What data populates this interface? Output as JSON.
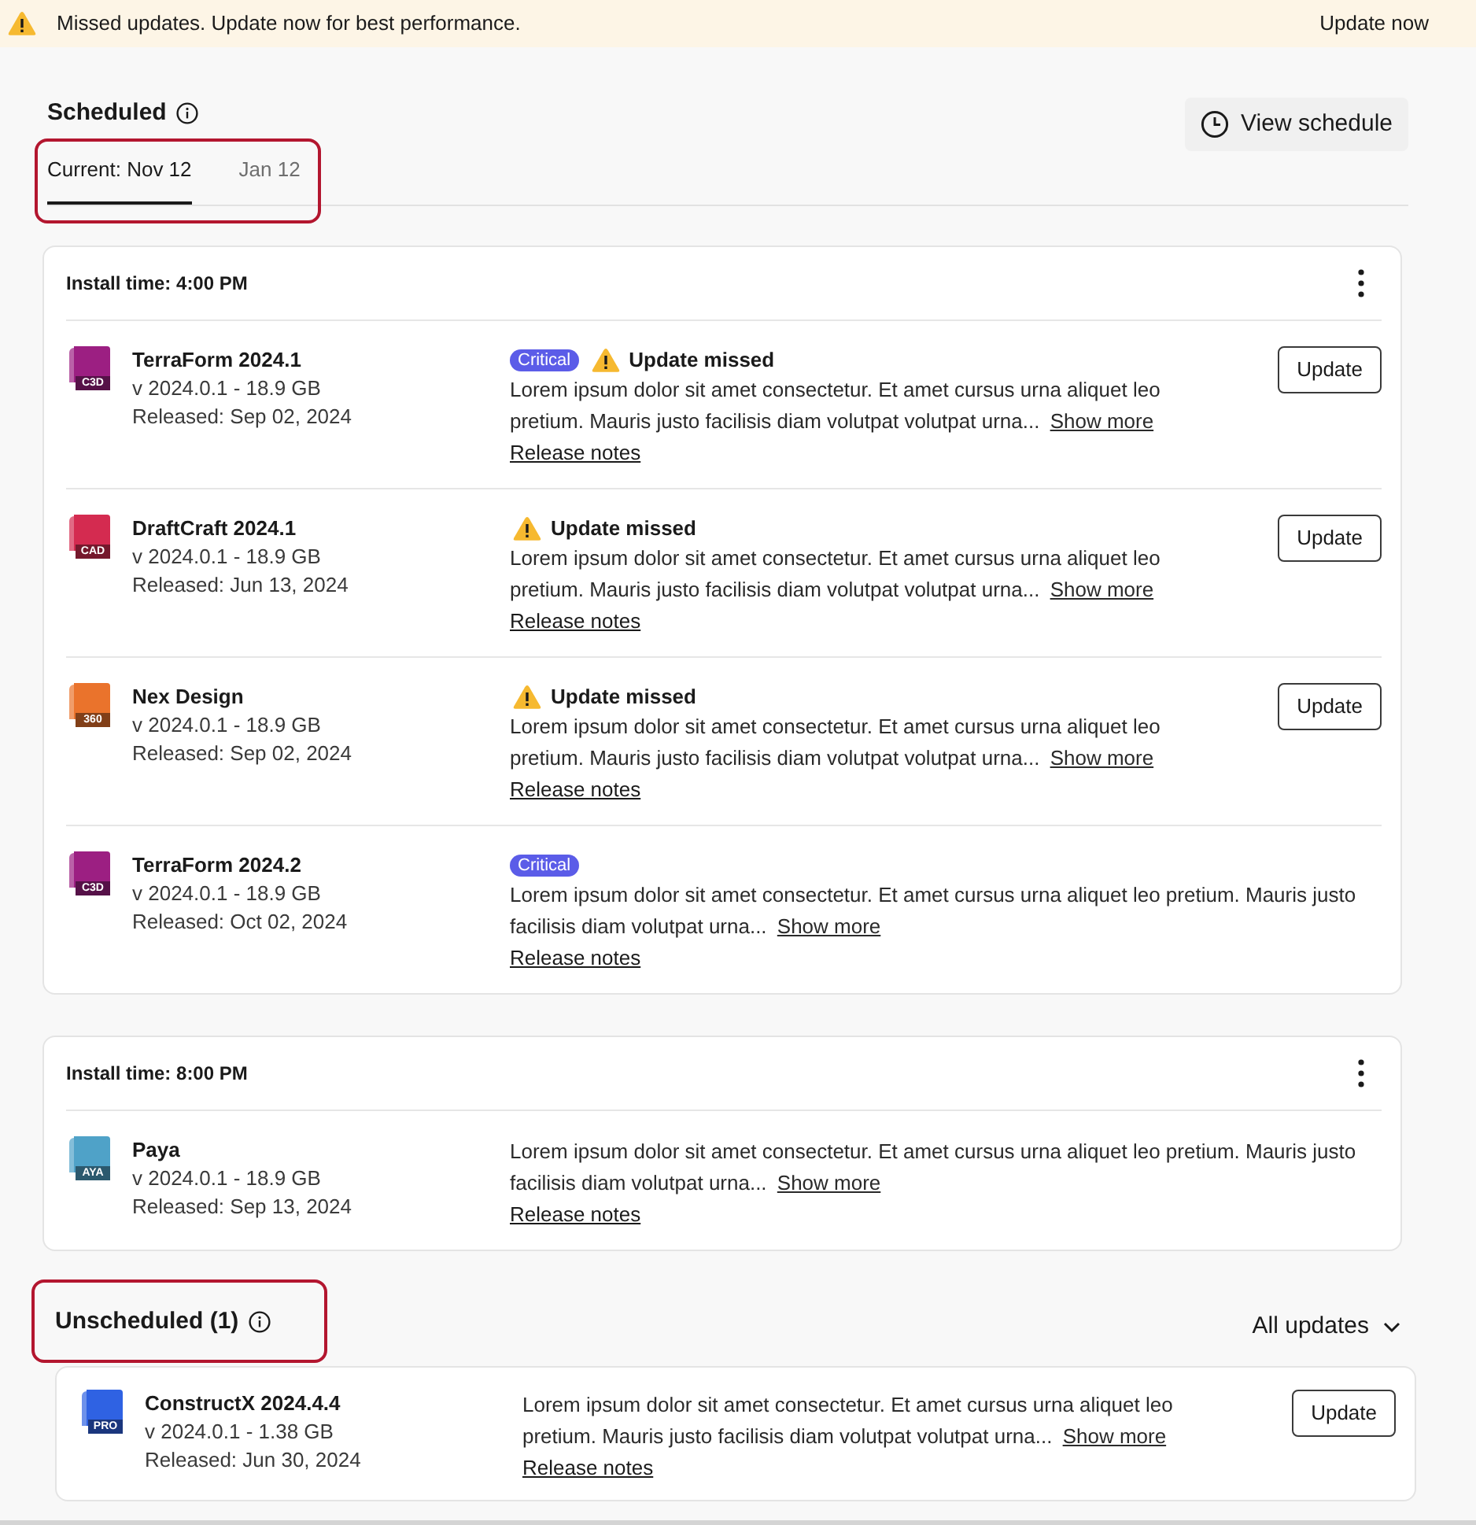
{
  "banner": {
    "message": "Missed updates. Update now for best performance.",
    "action": "Update now"
  },
  "scheduled": {
    "title": "Scheduled",
    "view_schedule": "View schedule",
    "tabs_highlighted": true,
    "tabs": [
      {
        "label": "Current: Nov 12",
        "selected": true
      },
      {
        "label": "Jan 12",
        "selected": false
      }
    ],
    "groups": [
      {
        "install_time": "Install time: 4:00 PM",
        "items": [
          {
            "name": "TerraForm 2024.1",
            "icon_label": "C3D",
            "color": "#9c1f82",
            "version": "v 2024.0.1 - 18.9 GB",
            "released": "Released: Sep 02, 2024",
            "badge": "Critical",
            "warning": "Update missed",
            "description": "Lorem ipsum dolor sit amet consectetur. Et amet cursus urna aliquet leo pretium. Mauris justo facilisis diam volutpat volutpat urna...",
            "show_more": "Show more",
            "release_notes": "Release notes",
            "action": "Update"
          },
          {
            "name": "DraftCraft 2024.1",
            "icon_label": "CAD",
            "color": "#d42b50",
            "version": "v 2024.0.1 - 18.9 GB",
            "released": "Released: Jun 13, 2024",
            "warning": "Update missed",
            "description": "Lorem ipsum dolor sit amet consectetur. Et amet cursus urna aliquet leo pretium. Mauris justo facilisis diam volutpat volutpat urna...",
            "show_more": "Show more",
            "release_notes": "Release notes",
            "action": "Update"
          },
          {
            "name": "Nex Design",
            "icon_label": "360",
            "color": "#ea732c",
            "version": "v 2024.0.1 - 18.9 GB",
            "released": "Released: Sep 02, 2024",
            "warning": "Update missed",
            "description": "Lorem ipsum dolor sit amet consectetur. Et amet cursus urna aliquet leo pretium. Mauris justo facilisis diam volutpat volutpat urna...",
            "show_more": "Show more",
            "release_notes": "Release notes",
            "action": "Update"
          },
          {
            "name": "TerraForm 2024.2",
            "icon_label": "C3D",
            "color": "#9c1f82",
            "version": "v 2024.0.1 - 18.9 GB",
            "released": "Released: Oct 02, 2024",
            "badge": "Critical",
            "description": "Lorem ipsum dolor sit amet consectetur. Et amet cursus urna aliquet leo pretium. Mauris justo facilisis diam volutpat urna...",
            "show_more": "Show more",
            "release_notes": "Release notes"
          }
        ]
      },
      {
        "install_time": "Install time: 8:00 PM",
        "items": [
          {
            "name": "Paya",
            "icon_label": "AYA",
            "color": "#4fa2c8",
            "version": "v 2024.0.1 - 18.9 GB",
            "released": "Released: Sep 13, 2024",
            "description": "Lorem ipsum dolor sit amet consectetur. Et amet cursus urna aliquet leo pretium. Mauris justo facilisis diam volutpat urna...",
            "show_more": "Show more",
            "release_notes": "Release notes"
          }
        ]
      }
    ]
  },
  "unscheduled": {
    "title": "Unscheduled (1)",
    "title_highlighted": true,
    "filter": "All updates",
    "items": [
      {
        "name": "ConstructX 2024.4.4",
        "icon_label": "PRO",
        "color": "#2f62e3",
        "version": "v 2024.0.1 - 1.38 GB",
        "released": "Released: Jun 30, 2024",
        "description": "Lorem ipsum dolor sit amet consectetur. Et amet cursus urna aliquet leo pretium. Mauris justo facilisis diam volutpat volutpat urna...",
        "show_more": "Show more",
        "release_notes": "Release notes",
        "action": "Update"
      }
    ]
  }
}
